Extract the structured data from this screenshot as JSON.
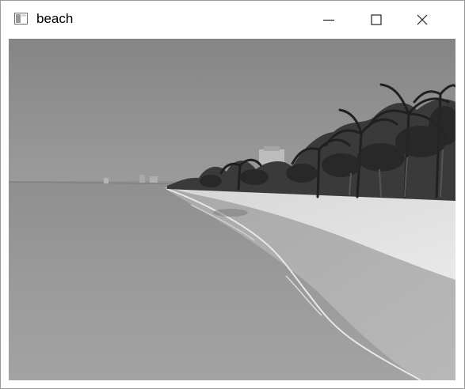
{
  "window": {
    "title": "beach",
    "icon": "window-app-icon",
    "controls": {
      "minimize_icon": "minimize-icon",
      "maximize_icon": "maximize-icon",
      "close_icon": "close-icon"
    }
  },
  "image": {
    "kind": "grayscale beach photo",
    "colors": {
      "sky": "#8e8e8e",
      "sea": "#979797",
      "sand": "#e2e2e2",
      "trees": "#2e2e2e"
    }
  }
}
